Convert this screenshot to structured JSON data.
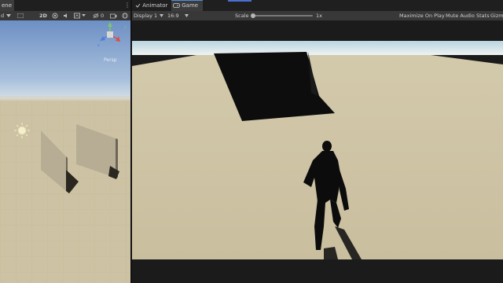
{
  "scene": {
    "tab_label": "ene",
    "more": "⋮",
    "toolbar": {
      "mode_fragment": "d",
      "toggle_2d": "2D",
      "persp_label": "Persp"
    }
  },
  "game": {
    "tabs": [
      {
        "label": "Animator",
        "icon": "animator-icon"
      },
      {
        "label": "Game",
        "icon": "game-controller-icon"
      }
    ],
    "toolbar": {
      "display": "Display 1",
      "aspect": "16:9",
      "scale_label": "Scale",
      "scale_value": "1x",
      "scale_level": 0,
      "maximize": "Maximize On Play",
      "mute": "Mute Audio",
      "stats": "Stats",
      "gizmos": "Gizmos"
    }
  },
  "colors": {
    "sky": "#dcecf0",
    "ground": "#cdc3a4",
    "shadow": "#111111",
    "accent_tab": "#4a8fe0"
  }
}
